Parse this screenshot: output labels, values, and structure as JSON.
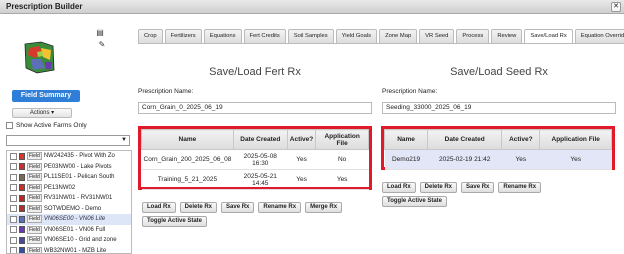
{
  "app_title": "Prescription Builder",
  "sidebar": {
    "field_summary_label": "Field Summary",
    "actions_label": "Actions ▾",
    "show_active_label": "Show Active Farms Only",
    "field_tag": "Field",
    "fields": [
      {
        "name": "NW242435 - Pivot With Zo",
        "swatch": "#d63a2c",
        "selected": false
      },
      {
        "name": "PE03NW00 - Lake Pivots",
        "swatch": "#c93030",
        "selected": false
      },
      {
        "name": "PL11SE01 - Pelican South",
        "swatch": "#7a6a5a",
        "selected": false
      },
      {
        "name": "PE13NW02",
        "swatch": "#c93030",
        "selected": false
      },
      {
        "name": "RV31NW01 - RV31NW01",
        "swatch": "#c02626",
        "selected": false
      },
      {
        "name": "SOTWDEMO - Demo",
        "swatch": "#b03030",
        "selected": false
      },
      {
        "name": "VN06SE00 - VN06 Lite",
        "swatch": "#5d6fb8",
        "selected": true
      },
      {
        "name": "VN06SE01 - VN06 Full",
        "swatch": "#6a3ab0",
        "selected": false
      },
      {
        "name": "VN06SE10 - Grid and zone",
        "swatch": "#4a4a9a",
        "selected": false
      },
      {
        "name": "WB32NW01 - MZB Lite",
        "swatch": "#3050a0",
        "selected": false
      }
    ]
  },
  "tabs": [
    "Crop",
    "Fertilizers",
    "Equations",
    "Fert Credits",
    "Soil Samples",
    "Yield Goals",
    "Zone Map",
    "VR Seed",
    "Process",
    "Review",
    "Save/Load Rx",
    "Equation Override"
  ],
  "active_tab": "Save/Load Rx",
  "fert_panel": {
    "title": "Save/Load Fert Rx",
    "name_label": "Prescription Name:",
    "name_value": "Corn_Grain_0_2025_06_19",
    "columns": [
      "Name",
      "Date Created",
      "Active?",
      "Application File"
    ],
    "rows": [
      {
        "name": "Corn_Grain_200_2025_06_08",
        "date": "2025-05-08 16:30",
        "active": "Yes",
        "file": "No",
        "highlight": false
      },
      {
        "name": "Training_5_21_2025",
        "date": "2025-05-21 14:45",
        "active": "Yes",
        "file": "Yes",
        "highlight": false
      }
    ],
    "buttons": [
      "Load Rx",
      "Delete Rx",
      "Save Rx",
      "Rename Rx",
      "Merge Rx"
    ],
    "toggle_label": "Toggle Active State"
  },
  "seed_panel": {
    "title": "Save/Load Seed Rx",
    "name_label": "Prescription Name:",
    "name_value": "Seeding_33000_2025_06_19",
    "columns": [
      "Name",
      "Date Created",
      "Active?",
      "Application File"
    ],
    "rows": [
      {
        "name": "Demo219",
        "date": "2025-02-19 21:42",
        "active": "Yes",
        "file": "Yes",
        "highlight": true
      }
    ],
    "buttons": [
      "Load Rx",
      "Delete Rx",
      "Save Rx",
      "Rename Rx"
    ],
    "toggle_label": "Toggle Active State"
  },
  "colors": {
    "accent": "#2f7ed8",
    "highlight_border": "#e11a2a"
  }
}
